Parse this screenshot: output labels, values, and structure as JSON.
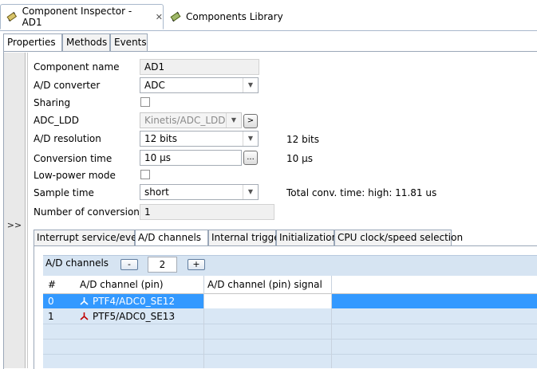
{
  "editor_tabs": [
    {
      "label": "Component Inspector - AD1",
      "close": "✕",
      "active": true
    },
    {
      "label": "Components Library",
      "active": false
    }
  ],
  "property_tabs": [
    "Properties",
    "Methods",
    "Events"
  ],
  "collapse_label": ">>",
  "properties": {
    "component_name": {
      "label": "Component name",
      "value": "AD1"
    },
    "ad_converter": {
      "label": "A/D converter",
      "value": "ADC"
    },
    "sharing": {
      "label": "Sharing",
      "checked": false
    },
    "adc_ldd": {
      "label": "ADC_LDD",
      "value": "Kinetis/ADC_LDD",
      "button": ">"
    },
    "ad_resolution": {
      "label": "A/D resolution",
      "value": "12 bits",
      "info": "12 bits"
    },
    "conversion_time": {
      "label": "Conversion time",
      "value": "10 µs",
      "button": "...",
      "info": "10 µs"
    },
    "low_power_mode": {
      "label": "Low-power mode",
      "checked": false
    },
    "sample_time": {
      "label": "Sample time",
      "value": "short",
      "info": "Total conv. time:  high: 11.81 us"
    },
    "number_of_conversions": {
      "label": "Number of conversions",
      "value": "1"
    }
  },
  "lower_tabs": [
    "Interrupt service/event",
    "A/D channels",
    "Internal trigger",
    "Initialization",
    "CPU clock/speed selection"
  ],
  "channels": {
    "title": "A/D channels",
    "decrement": "-",
    "count": "2",
    "increment": "+",
    "columns": [
      "#",
      "A/D channel (pin)",
      "A/D channel (pin) signal"
    ],
    "rows": [
      {
        "index": "0",
        "pin": "PTF4/ADC0_SE12",
        "signal": "",
        "selected": true
      },
      {
        "index": "1",
        "pin": "PTF5/ADC0_SE13",
        "signal": "",
        "selected": false
      }
    ]
  },
  "colors": {
    "selection": "#3399ff",
    "table_bg": "#d9e7f5",
    "pin_icon": "#c00000"
  }
}
